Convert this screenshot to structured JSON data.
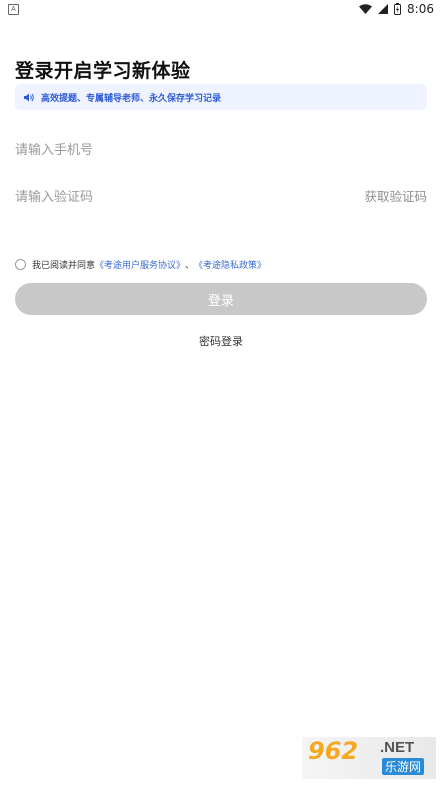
{
  "status": {
    "app_badge": "A",
    "time": "8:06"
  },
  "header": {
    "title": "登录开启学习新体验",
    "notice": "高效提题、专属辅导老师、永久保存学习记录"
  },
  "form": {
    "phone_placeholder": "请输入手机号",
    "code_placeholder": "请输入验证码",
    "get_code": "获取验证码"
  },
  "agreement": {
    "prefix": "我已阅读并同意",
    "user_agreement": "《考途用户服务协议》",
    "separator": "、",
    "privacy_policy": "《考途隐私政策》"
  },
  "actions": {
    "login": "登录",
    "password_login": "密码登录"
  },
  "watermark": {
    "number": "962",
    "domain": ".NET",
    "site": "乐游网"
  },
  "colors": {
    "accent": "#3b6bd6",
    "notice_bg": "#eef3ff",
    "button_disabled": "#c8c8c8"
  }
}
